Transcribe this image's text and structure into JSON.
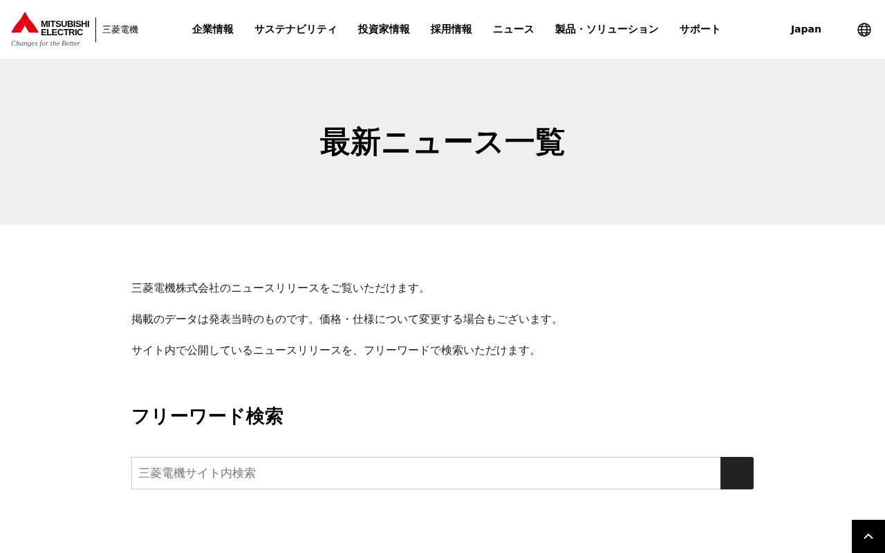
{
  "logo": {
    "line_1": "MITSUBISHI",
    "line_2": "ELECTRIC",
    "tagline": "Changes for the Better",
    "name_ja": "三菱電機"
  },
  "nav": [
    "企業情報",
    "サステナビリティ",
    "投資家情報",
    "採用情報",
    "ニュース",
    "製品・ソリューション",
    "サポート"
  ],
  "region": "Japan",
  "hero": {
    "title": "最新ニュース一覧"
  },
  "intro": [
    "三菱電機株式会社のニュースリリースをご覧いただけます。",
    "掲載のデータは発表当時のものです。価格・仕様について変更する場合もございます。",
    "サイト内で公開しているニュースリリースを、フリーワードで検索いただけます。"
  ],
  "search": {
    "heading": "フリーワード検索",
    "placeholder": "三菱電機サイト内検索"
  }
}
